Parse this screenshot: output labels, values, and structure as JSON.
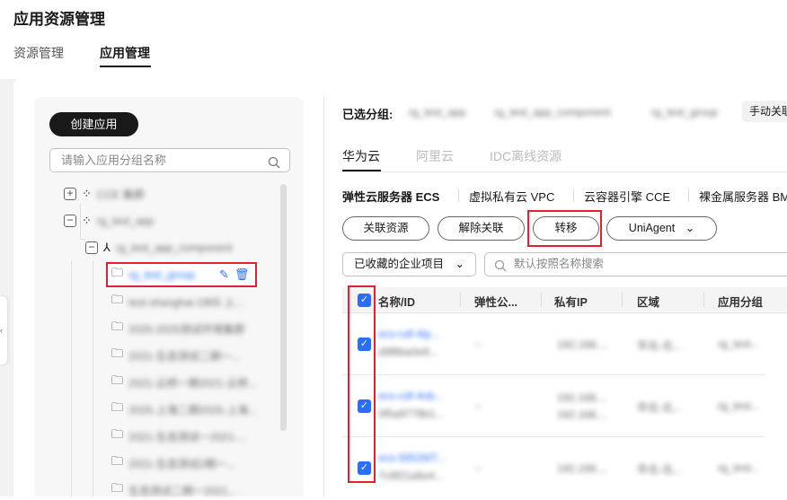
{
  "page": {
    "title": "应用资源管理",
    "tabs": [
      {
        "label": "资源管理"
      },
      {
        "label": "应用管理",
        "active": true
      }
    ]
  },
  "left": {
    "create_button": "创建应用",
    "search_placeholder": "请输入应用分组名称",
    "tree": [
      {
        "label": "CCE 集群",
        "level": 0,
        "toggle": "+"
      },
      {
        "label": "rg_test_app",
        "level": 0,
        "toggle": "−"
      },
      {
        "label": "rg_test_app_component",
        "level": 1,
        "toggle": "−"
      },
      {
        "label": "rg_test_group",
        "level": 2,
        "selected": true
      },
      {
        "label": "test-shanghai-1905 上...",
        "level": 2
      },
      {
        "label": "2025-2025测试环境集群",
        "level": 2
      },
      {
        "label": "2021-生态测试二期一...",
        "level": 2
      },
      {
        "label": "2021-云桥一期2021-云桥...",
        "level": 2
      },
      {
        "label": "2025-上海二期2025-上海...",
        "level": 2
      },
      {
        "label": "2021-生态测试一2021-...",
        "level": 2
      },
      {
        "label": "2021-生态测试2期一...",
        "level": 2
      },
      {
        "label": "生态测试二期一2021...",
        "level": 2
      }
    ]
  },
  "right": {
    "selected_label": "已选分组:",
    "selected_path": [
      "rg_test_app",
      "rg_test_app_component",
      "rg_test_group"
    ],
    "manual_button": "手动关联",
    "cloud_tabs": [
      "华为云",
      "阿里云",
      "IDC离线资源"
    ],
    "service_tabs": [
      "弹性云服务器 ECS",
      "虚拟私有云 VPC",
      "云容器引擎 CCE",
      "裸金属服务器 BMS"
    ],
    "actions": {
      "associate": "关联资源",
      "disassociate": "解除关联",
      "transfer": "转移",
      "uniagent": "UniAgent"
    },
    "project_dropdown": "已收藏的企业项目",
    "search_placeholder": "默认按照名称搜索",
    "columns": [
      "名称/ID",
      "弹性公...",
      "私有IP",
      "区域",
      "应用分组"
    ],
    "rows": [
      {
        "name": "ecs-cdf-4ip...",
        "id": "d9f8ba0e9...",
        "eip": "--",
        "ip": [
          "192.168...."
        ],
        "region": "华北-北...",
        "group": "rg_test..."
      },
      {
        "name": "ecs-cdf-4ob...",
        "id": "0f5a9778b1...",
        "eip": "--",
        "ip": [
          "192.168....",
          "192.168...."
        ],
        "region": "华北-北...",
        "group": "rg_test..."
      },
      {
        "name": "ecs-5652bf7...",
        "id": "7c9f21a6e4...",
        "eip": "--",
        "ip": [
          "192.168...."
        ],
        "region": "华北-北...",
        "group": "rg_test..."
      }
    ]
  }
}
